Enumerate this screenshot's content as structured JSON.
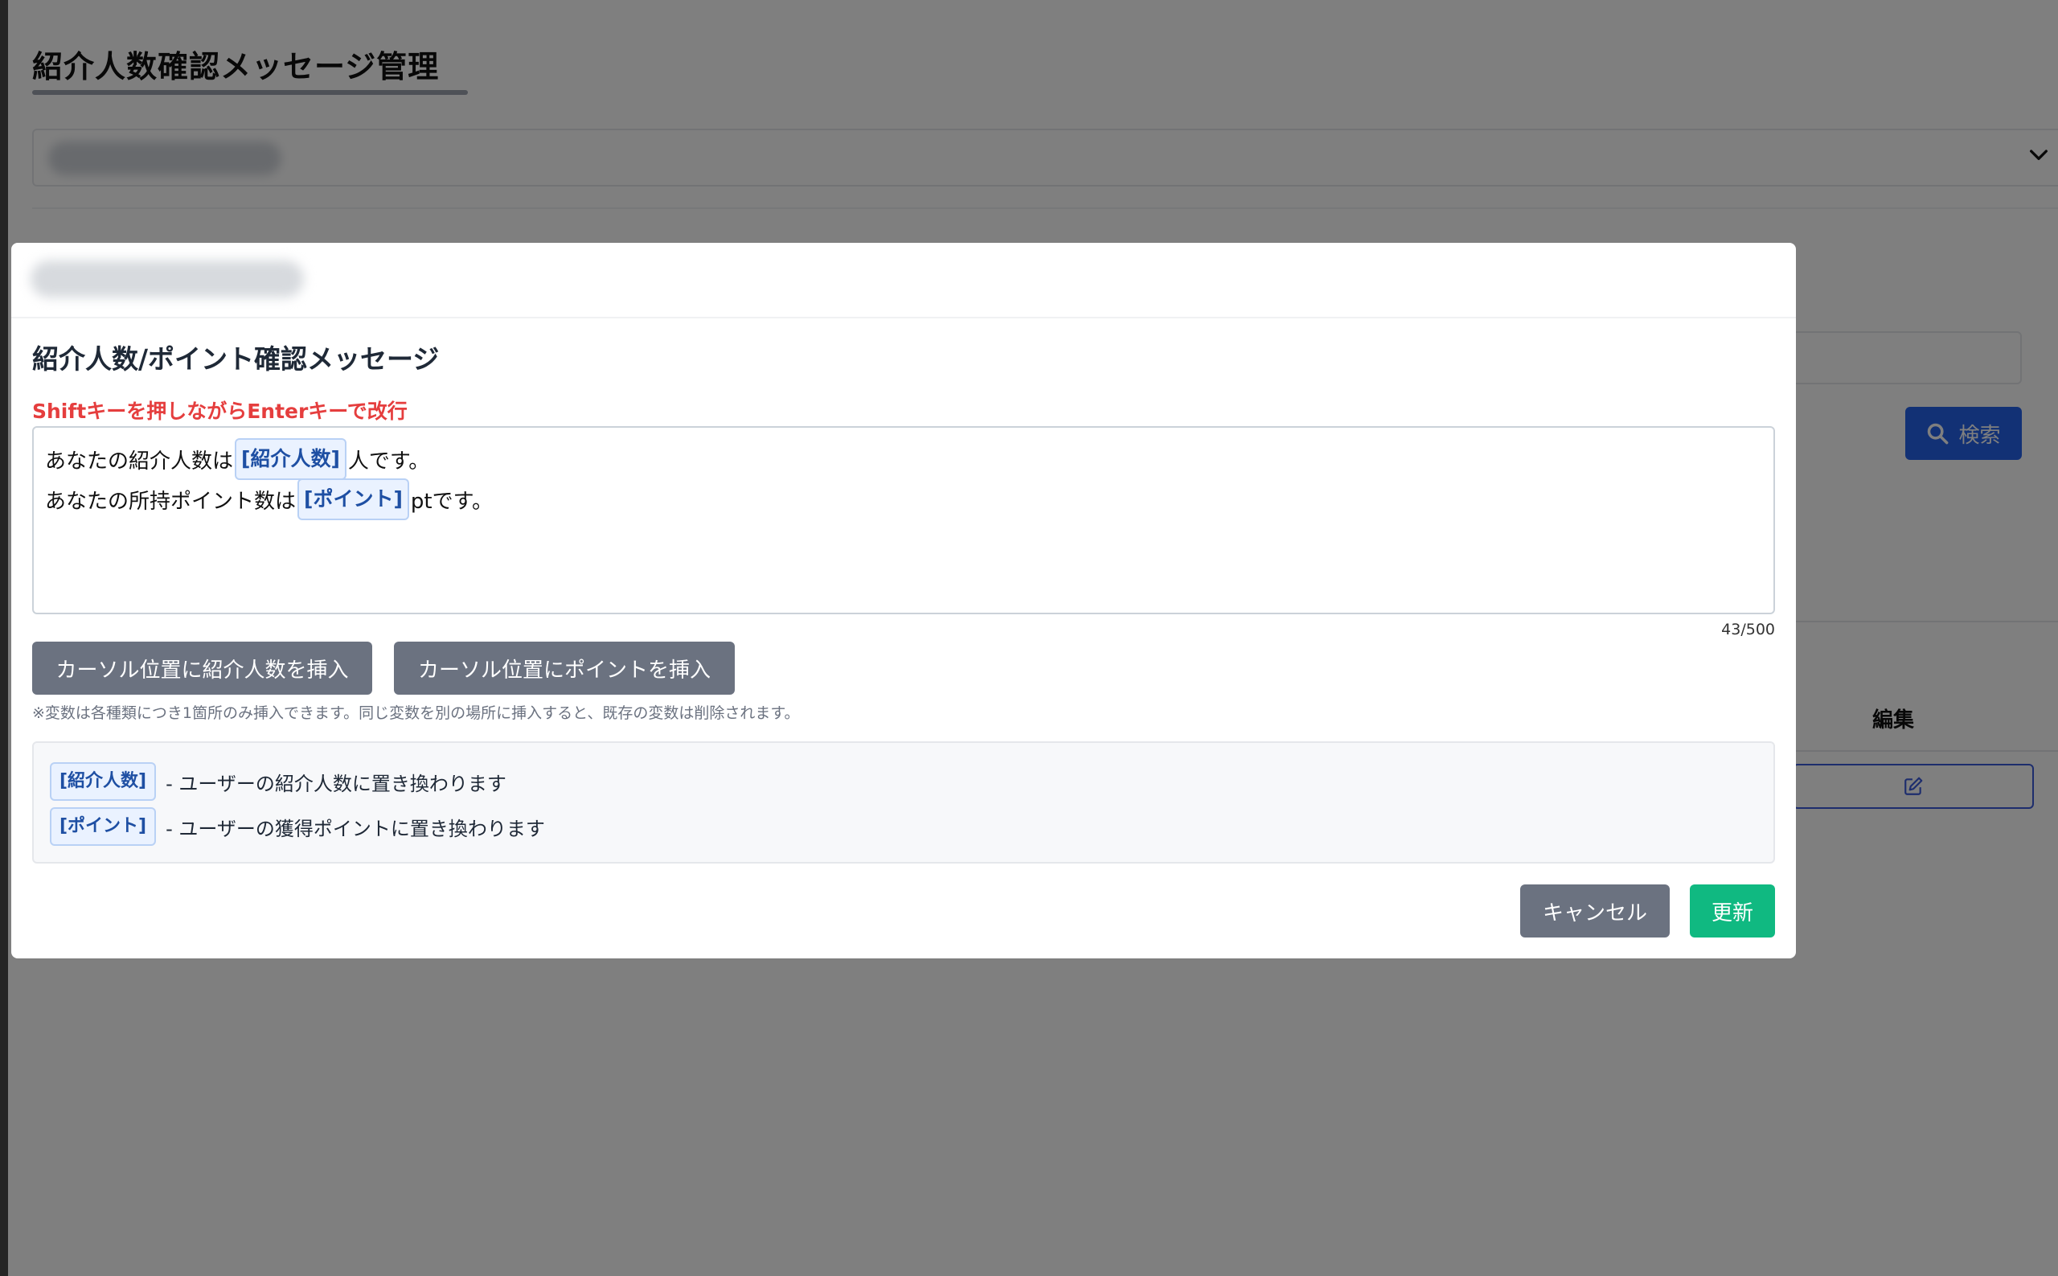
{
  "page": {
    "title": "紹介人数確認メッセージ管理"
  },
  "background": {
    "search_label": "検索",
    "table_header_edit": "編集"
  },
  "modal": {
    "section_title": "紹介人数/ポイント確認メッセージ",
    "hint": "Shiftキーを押しながらEnterキーで改行",
    "message_lines": [
      {
        "before": "あなたの紹介人数は",
        "variable": "[紹介人数]",
        "after": "人です。"
      },
      {
        "before": "あなたの所持ポイント数は",
        "variable": "[ポイント]",
        "after": "ptです。"
      }
    ],
    "char_count": "43/500",
    "insert_referral_label": "カーソル位置に紹介人数を挿入",
    "insert_point_label": "カーソル位置にポイントを挿入",
    "note": "※変数は各種類につき1箇所のみ挿入できます。同じ変数を別の場所に挿入すると、既存の変数は削除されます。",
    "legend": [
      {
        "variable": "[紹介人数]",
        "description": "- ユーザーの紹介人数に置き換わります"
      },
      {
        "variable": "[ポイント]",
        "description": "- ユーザーの獲得ポイントに置き換わります"
      }
    ],
    "cancel_label": "キャンセル",
    "update_label": "更新"
  },
  "colors": {
    "primary": "#2563eb",
    "secondary": "#6b7280",
    "success": "#10b981",
    "danger": "#e53e3e",
    "variable_chip": "#eaf2ff"
  }
}
